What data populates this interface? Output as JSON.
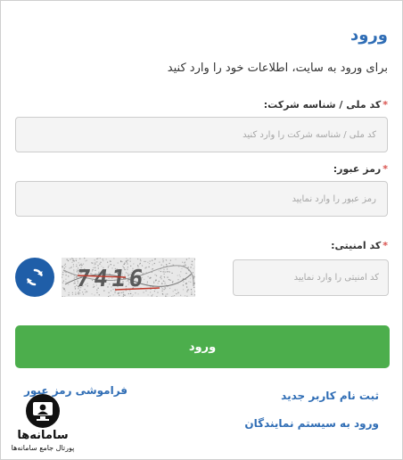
{
  "form": {
    "title": "ورود",
    "subtitle": "برای ورود به سایت، اطلاعات خود را وارد کنید",
    "required_mark": "*",
    "national_id": {
      "label": "کد ملی / شناسه شرکت:",
      "placeholder": "کد ملی / شناسه شرکت را وارد کنید"
    },
    "password": {
      "label": "رمز عبور:",
      "placeholder": "رمز عبور را وارد نمایید"
    },
    "captcha": {
      "label": "کد امنیتی:",
      "placeholder": "کد امنیتی را وارد نمایید",
      "image_text": "7416"
    },
    "submit_label": "ورود"
  },
  "links": {
    "forgot_password": "فراموشی رمز عبور",
    "register": "ثبت نام کاربر جدید",
    "agents_login": "ورود به سیستم نمایندگان"
  },
  "watermark": {
    "name": "سامانه‌ها",
    "tagline": "پورتال جامع سامانه‌ها"
  },
  "colors": {
    "accent": "#2f6db5",
    "submit": "#4cae4c",
    "required": "#d9534f",
    "refresh": "#1f5ea8"
  },
  "icons": {
    "refresh": "refresh-icon",
    "logo": "monitor-person-icon"
  }
}
